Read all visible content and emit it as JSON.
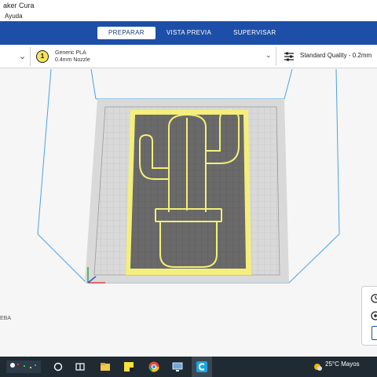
{
  "window": {
    "title": "aker Cura"
  },
  "menu": {
    "help": "Ayuda"
  },
  "stages": [
    {
      "label": "PREPARAR",
      "active": true
    },
    {
      "label": "VISTA PREVIA",
      "active": false
    },
    {
      "label": "SUPERVISAR",
      "active": false
    }
  ],
  "extruder": {
    "number": "1",
    "material": "Generic PLA",
    "nozzle": "0.4mm Nozzle",
    "color": "#f8e45a"
  },
  "quality": {
    "label": "Standard Quality - 0.2mm"
  },
  "viewport": {
    "side_label": "EBA"
  },
  "taskbar": {
    "temperature": "25°C",
    "location": "Mayos"
  },
  "colors": {
    "header": "#1e4fa8",
    "model": "#f4ef7a",
    "plate_grid": "#8a8a8a",
    "build_volume": "#4aa3e6"
  }
}
